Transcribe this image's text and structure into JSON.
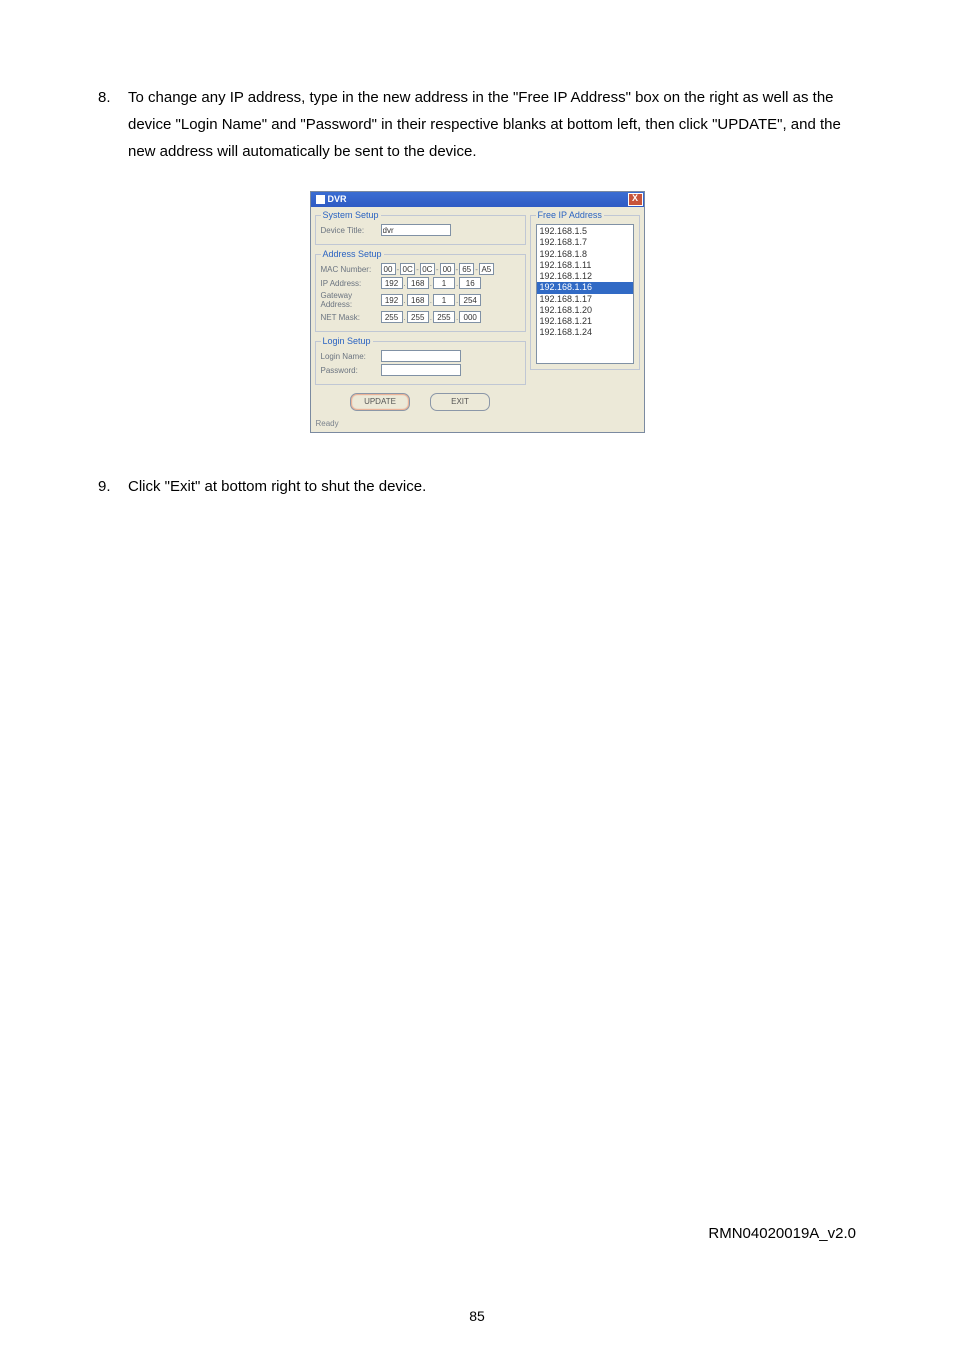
{
  "item8": {
    "num": "8.",
    "text": "To change any IP address, type in the new address in the \"Free IP Address\" box on the right as well as the device \"Login Name\" and \"Password\" in their respective blanks at bottom left, then click \"UPDATE\", and the new address will automatically be sent to the device."
  },
  "item9": {
    "num": "9.",
    "text": "Click \"Exit\" at bottom right to shut the device."
  },
  "dvr": {
    "title": "DVR",
    "closeGlyph": "X",
    "systemSetup": {
      "legend": "System Setup",
      "deviceTitleLabel": "Device Title:",
      "deviceTitleValue": "dvr"
    },
    "addressSetup": {
      "legend": "Address Setup",
      "macLabel": "MAC Number:",
      "mac": [
        "00",
        "0C",
        "0C",
        "00",
        "65",
        "A5"
      ],
      "macSep": "-",
      "ipLabel": "IP Address:",
      "ip": [
        "192",
        "168",
        "1",
        "16"
      ],
      "gatewayLabel": "Gateway Address:",
      "gateway": [
        "192",
        "168",
        "1",
        "254"
      ],
      "netmaskLabel": "NET Mask:",
      "netmask": [
        "255",
        "255",
        "255",
        "000"
      ],
      "dotSep": "."
    },
    "loginSetup": {
      "legend": "Login Setup",
      "loginNameLabel": "Login Name:",
      "passwordLabel": "Password:",
      "loginNameValue": "",
      "passwordValue": ""
    },
    "buttons": {
      "update": "UPDATE",
      "exit": "EXIT"
    },
    "freeIp": {
      "legend": "Free IP Address",
      "items": [
        "192.168.1.5",
        "192.168.1.7",
        "192.168.1.8",
        "192.168.1.11",
        "192.168.1.12",
        "192.168.1.16",
        "192.168.1.17",
        "192.168.1.20",
        "192.168.1.21",
        "192.168.1.24"
      ],
      "selectedIndex": 5
    },
    "status": "Ready"
  },
  "footerRight": "RMN04020019A_v2.0",
  "pageNumber": "85"
}
